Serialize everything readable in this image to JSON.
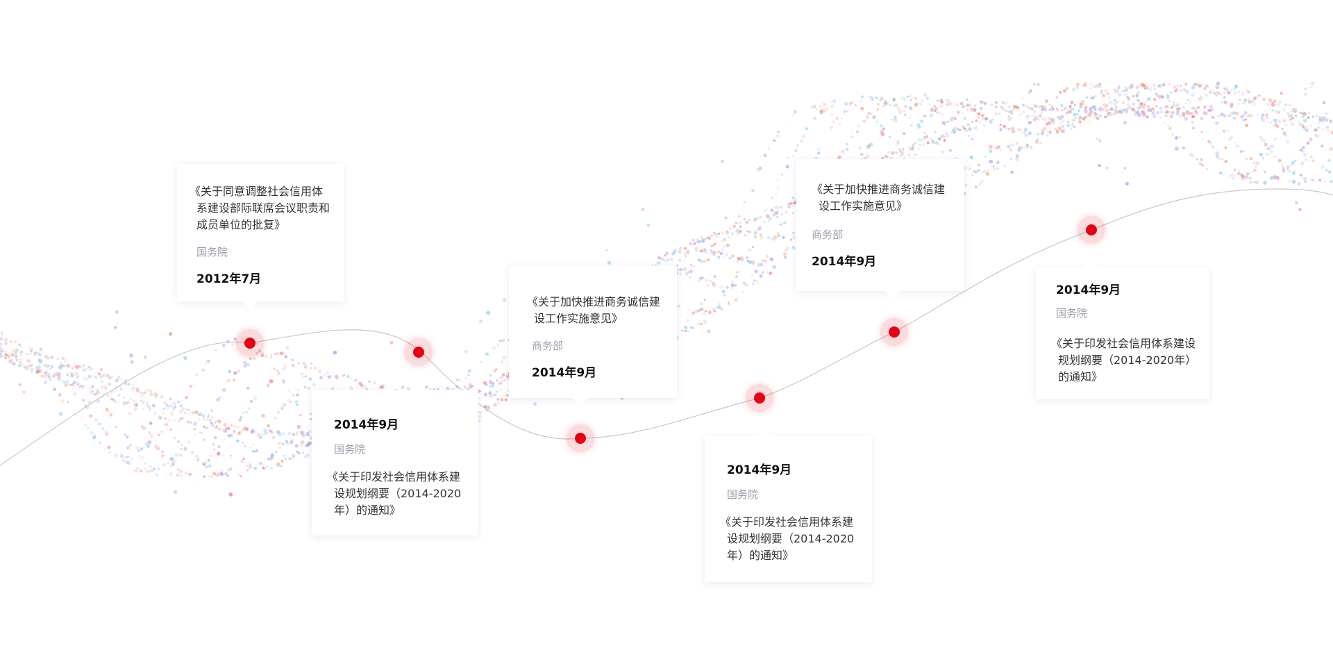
{
  "timeline": {
    "events": [
      {
        "title": "《关于同意调整社会信用体系建设部际联席会议职责和成员单位的批复》",
        "issuer": "国务院",
        "date": "2012年7月"
      },
      {
        "title": "《关于印发社会信用体系建设规划纲要（2014-2020年）的通知》",
        "issuer": "国务院",
        "date": "2014年9月"
      },
      {
        "title": "《关于加快推进商务诚信建设工作实施意见》",
        "issuer": "商务部",
        "date": "2014年9月"
      },
      {
        "title": "《关于印发社会信用体系建设规划纲要（2014-2020年）的通知》",
        "issuer": "国务院",
        "date": "2014年9月"
      },
      {
        "title": "《关于加快推进商务诚信建设工作实施意见》",
        "issuer": "商务部",
        "date": "2014年9月"
      },
      {
        "title": "《关于印发社会信用体系建设规划纲要（2014-2020年）的通知》",
        "issuer": "国务院",
        "date": "2014年9月"
      }
    ]
  },
  "colors": {
    "marker": "#e60012",
    "curve": "#cccccc",
    "particles": [
      "#f4a58a",
      "#b9a6f2",
      "#8ecff0",
      "#f7c7b5",
      "#c9b8f6",
      "#9fd8f3",
      "#f08a8a"
    ]
  }
}
